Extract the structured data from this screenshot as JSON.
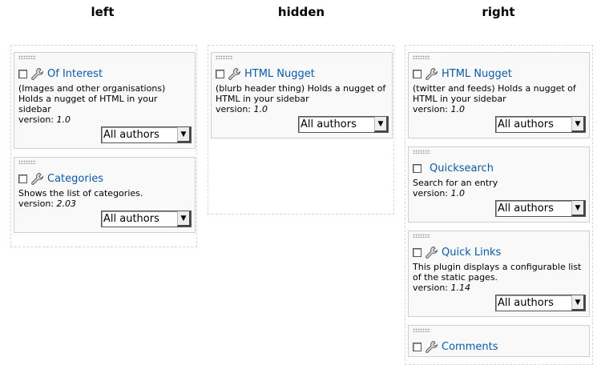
{
  "columns": {
    "left": {
      "title": "left",
      "plugins": [
        {
          "title": "Of Interest",
          "description": "(Images and other organisations) Holds a nugget of HTML in your sidebar",
          "version_label": "version:",
          "version": "1.0",
          "author_select": "All authors"
        },
        {
          "title": "Categories",
          "description": "Shows the list of categories.",
          "version_label": "version:",
          "version": "2.03",
          "author_select": "All authors"
        }
      ]
    },
    "hidden": {
      "title": "hidden",
      "plugins": [
        {
          "title": "HTML Nugget",
          "description": "(blurb header thing) Holds a nugget of HTML in your sidebar",
          "version_label": "version:",
          "version": "1.0",
          "author_select": "All authors"
        }
      ]
    },
    "right": {
      "title": "right",
      "plugins": [
        {
          "title": "HTML Nugget",
          "description": "(twitter and feeds) Holds a nugget of HTML in your sidebar",
          "version_label": "version:",
          "version": "1.0",
          "author_select": "All authors"
        },
        {
          "title": "Quicksearch",
          "description": "Search for an entry",
          "version_label": "version:",
          "version": "1.0",
          "author_select": "All authors"
        },
        {
          "title": "Quick Links",
          "description": "This plugin displays a configurable list of the static pages.",
          "version_label": "version:",
          "version": "1.14",
          "author_select": "All authors"
        },
        {
          "title": "Comments"
        }
      ]
    }
  },
  "icons": {
    "drag": "drag-handle-icon",
    "config": "wrench-icon"
  },
  "colors": {
    "link": "#0b5aa8",
    "plugin_bg": "#f9f9f9",
    "plugin_border": "#cfcfcf"
  }
}
